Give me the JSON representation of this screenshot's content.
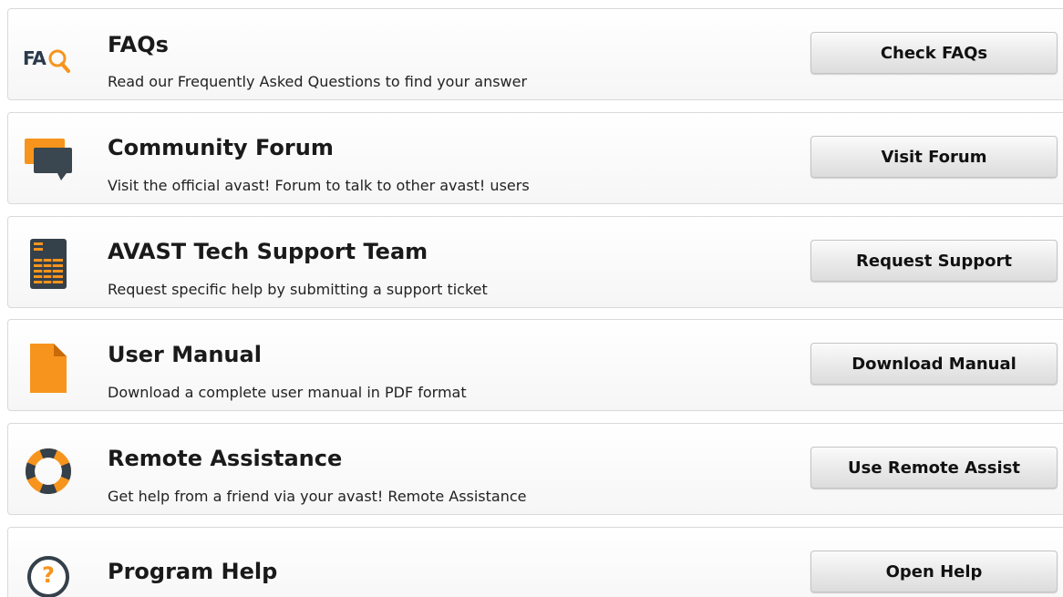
{
  "items": [
    {
      "icon": "faq-magnifier-icon",
      "icon_text": "FA",
      "title": "FAQs",
      "description": "Read our Frequently Asked Questions to find your answer",
      "button": "Check FAQs"
    },
    {
      "icon": "chat-bubbles-icon",
      "title": "Community Forum",
      "description": "Visit the official avast! Forum to talk to other avast! users",
      "button": "Visit Forum"
    },
    {
      "icon": "support-ticket-icon",
      "title": "AVAST Tech Support Team",
      "description": "Request specific help by submitting a support ticket",
      "button": "Request Support"
    },
    {
      "icon": "document-icon",
      "title": "User Manual",
      "description": "Download a complete user manual in PDF format",
      "button": "Download Manual"
    },
    {
      "icon": "lifebuoy-icon",
      "title": "Remote Assistance",
      "description": "Get help from a friend via your avast! Remote Assistance",
      "button": "Use Remote Assist"
    },
    {
      "icon": "question-mark-icon",
      "icon_text": "?",
      "title": "Program Help",
      "button": "Open Help"
    }
  ],
  "colors": {
    "accent_orange": "#f7941d",
    "dark_icon": "#34404a"
  }
}
